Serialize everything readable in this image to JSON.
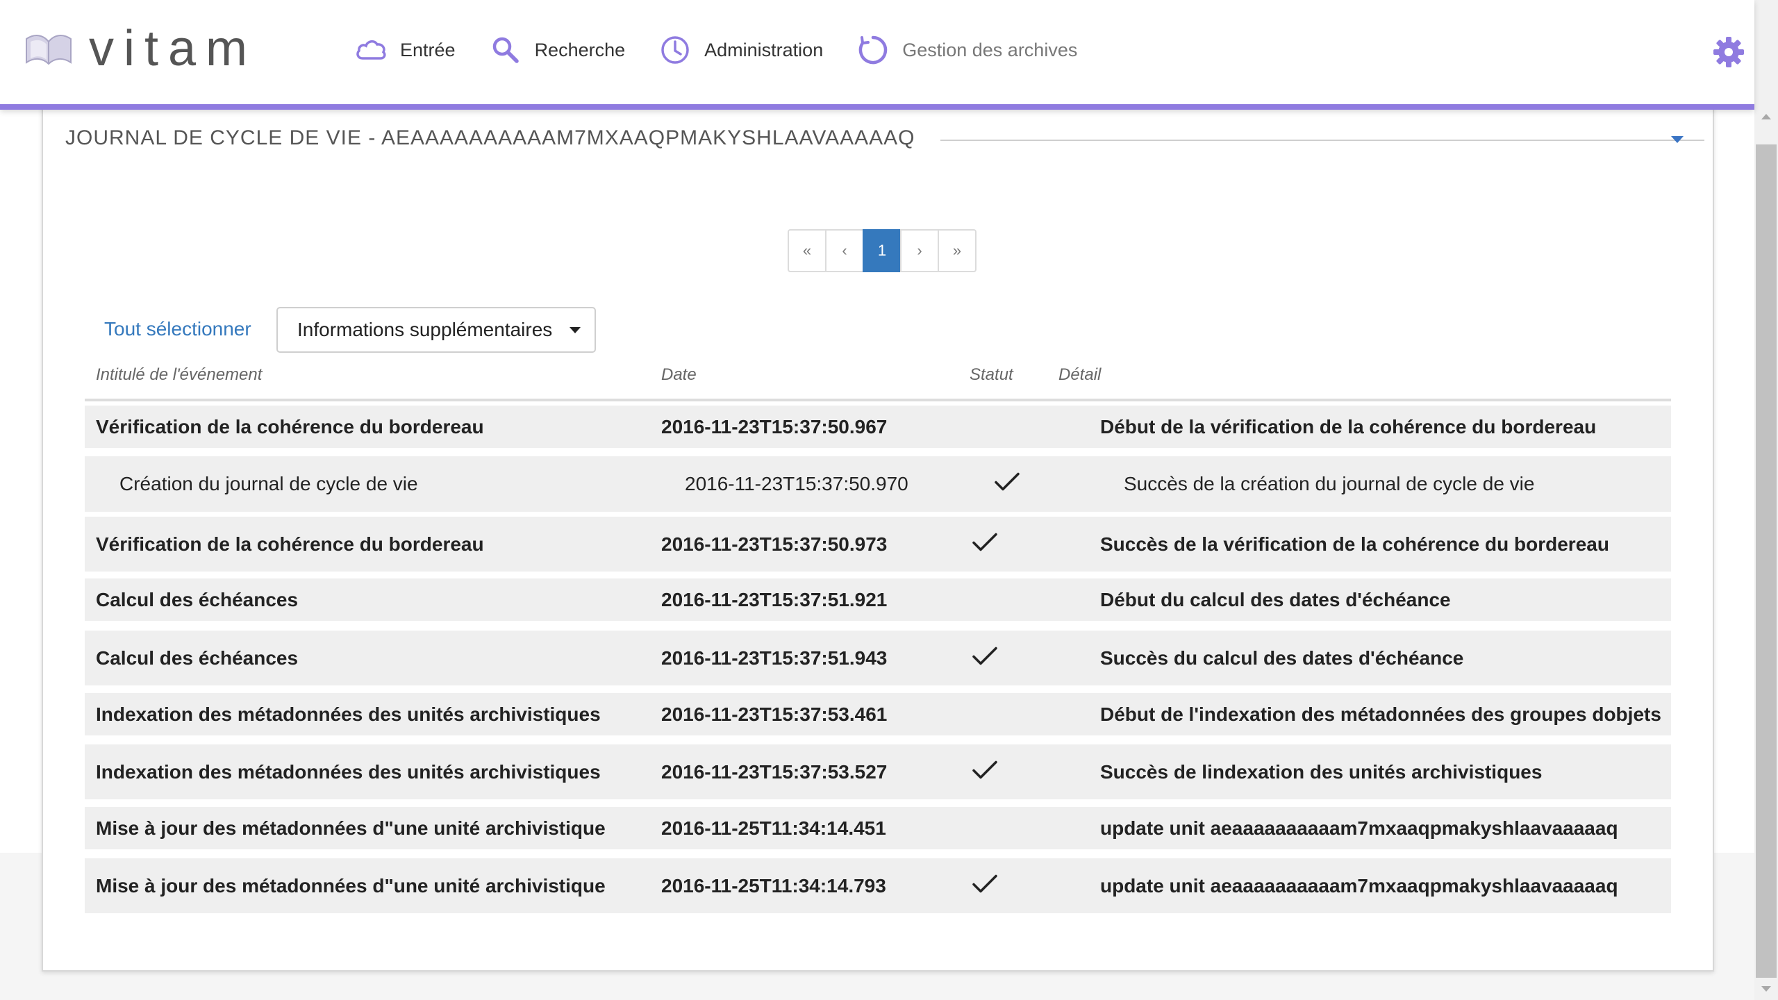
{
  "app": {
    "name": "vitam"
  },
  "nav": {
    "items": [
      {
        "label": "Entrée",
        "icon": "cloud-icon"
      },
      {
        "label": "Recherche",
        "icon": "search-icon"
      },
      {
        "label": "Administration",
        "icon": "clock-icon"
      },
      {
        "label": "Gestion des archives",
        "icon": "spinner-icon"
      }
    ]
  },
  "panel": {
    "title": "JOURNAL DE CYCLE DE VIE - AEAAAAAAAAAAM7MXAAQPMAKYSHLAAVAAAAAQ"
  },
  "pagination": {
    "first": "«",
    "prev": "‹",
    "current": "1",
    "next": "›",
    "last": "»"
  },
  "actions": {
    "select_all": "Tout sélectionner",
    "info_dropdown": "Informations supplémentaires"
  },
  "table": {
    "headers": {
      "event": "Intitulé de l'événement",
      "date": "Date",
      "status": "Statut",
      "detail": "Détail"
    },
    "rows": [
      {
        "event": "Vérification de la cohérence du bordereau",
        "date": "2016-11-23T15:37:50.967",
        "ok": false,
        "detail": "Début de la vérification de la cohérence du bordereau",
        "sub": false
      },
      {
        "event": "Création du journal de cycle de vie",
        "date": "2016-11-23T15:37:50.970",
        "ok": true,
        "detail": "Succès de la création du journal de cycle de vie",
        "sub": true
      },
      {
        "event": "Vérification de la cohérence du bordereau",
        "date": "2016-11-23T15:37:50.973",
        "ok": true,
        "detail": "Succès de la vérification de la cohérence du bordereau",
        "sub": false
      },
      {
        "event": "Calcul des échéances",
        "date": "2016-11-23T15:37:51.921",
        "ok": false,
        "detail": "Début du calcul des dates d'échéance",
        "sub": false
      },
      {
        "event": "Calcul des échéances",
        "date": "2016-11-23T15:37:51.943",
        "ok": true,
        "detail": "Succès du calcul des dates d'échéance",
        "sub": false
      },
      {
        "event": "Indexation des métadonnées des unités archivistiques",
        "date": "2016-11-23T15:37:53.461",
        "ok": false,
        "detail": "Début de l'indexation des métadonnées des groupes dobjets",
        "sub": false
      },
      {
        "event": "Indexation des métadonnées des unités archivistiques",
        "date": "2016-11-23T15:37:53.527",
        "ok": true,
        "detail": "Succès de lindexation des unités archivistiques",
        "sub": false
      },
      {
        "event": "Mise à jour des métadonnées d\"une unité archivistique",
        "date": "2016-11-25T11:34:14.451",
        "ok": false,
        "detail": "update unit aeaaaaaaaaaam7mxaaqpmakyshlaavaaaaaq",
        "sub": false
      },
      {
        "event": "Mise à jour des métadonnées d\"une unité archivistique",
        "date": "2016-11-25T11:34:14.793",
        "ok": true,
        "detail": "update unit aeaaaaaaaaaam7mxaaqpmakyshlaavaaaaaq",
        "sub": false
      }
    ]
  },
  "colors": {
    "accent": "#8f7be0",
    "primary": "#3579bd",
    "row_bg": "#efefef"
  }
}
